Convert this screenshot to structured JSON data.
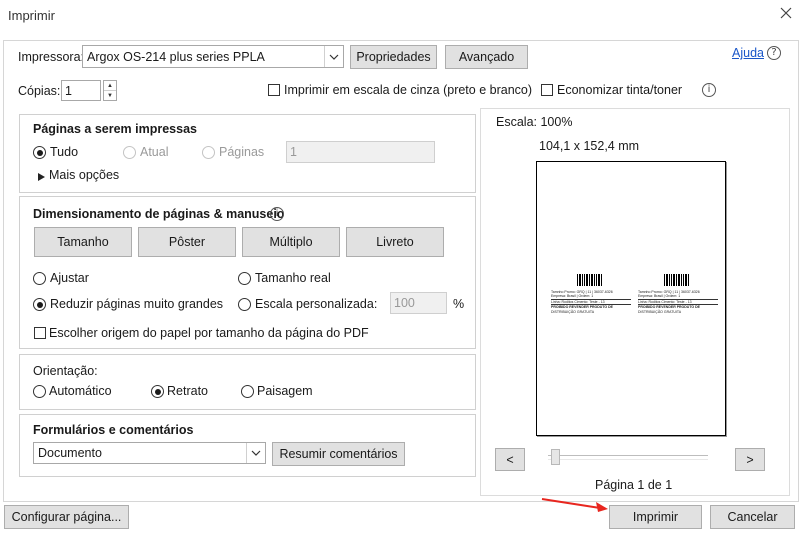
{
  "window": {
    "title": "Imprimir"
  },
  "printer": {
    "label": "Impressora:",
    "value": "Argox OS-214 plus series PPLA",
    "properties_label": "Propriedades",
    "advanced_label": "Avançado"
  },
  "help": {
    "label": "Ajuda"
  },
  "copies": {
    "label": "Cópias:",
    "value": "1"
  },
  "options": {
    "grayscale_label": "Imprimir em escala de cinza (preto e branco)",
    "save_ink_label": "Economizar tinta/toner"
  },
  "pages": {
    "heading": "Páginas a serem impressas",
    "all_label": "Tudo",
    "current_label": "Atual",
    "pages_label": "Páginas",
    "pages_value": "1",
    "more_label": "Mais opções"
  },
  "sizing": {
    "heading": "Dimensionamento de páginas & manuseio",
    "size_label": "Tamanho",
    "poster_label": "Pôster",
    "multiple_label": "Múltiplo",
    "booklet_label": "Livreto",
    "fit_label": "Ajustar",
    "actual_label": "Tamanho real",
    "shrink_label": "Reduzir páginas muito grandes",
    "custom_label": "Escala personalizada:",
    "custom_value": "100",
    "percent": "%",
    "source_label": "Escolher origem do papel por tamanho da página do PDF"
  },
  "orientation": {
    "heading": "Orientação:",
    "auto_label": "Automático",
    "portrait_label": "Retrato",
    "landscape_label": "Paisagem"
  },
  "forms": {
    "heading": "Formulários e comentários",
    "value": "Documento",
    "summarize_label": "Resumir comentários"
  },
  "preview": {
    "scale": "Escala: 100%",
    "size": "104,1 x 152,4 mm",
    "prev": "<",
    "next": ">",
    "page_label": "Página 1 de 1",
    "label_line1": "Tamnho Promo: GRQ | 11 | 36037-6326",
    "label_line2": "Empresa: Brasil | Ordem: 1",
    "label_line3": "Linha: Roditos Cimento: Teste - 13",
    "label_line4": "PROIBIDO REVENDER PRODUTO DE",
    "label_line5": "DISTRIBUIÇÃO GRATUITA"
  },
  "footer": {
    "setup_label": "Configurar página...",
    "print_label": "Imprimir",
    "cancel_label": "Cancelar"
  },
  "colors": {
    "annotation_arrow": "#e8261f",
    "link": "#1a56c8"
  }
}
